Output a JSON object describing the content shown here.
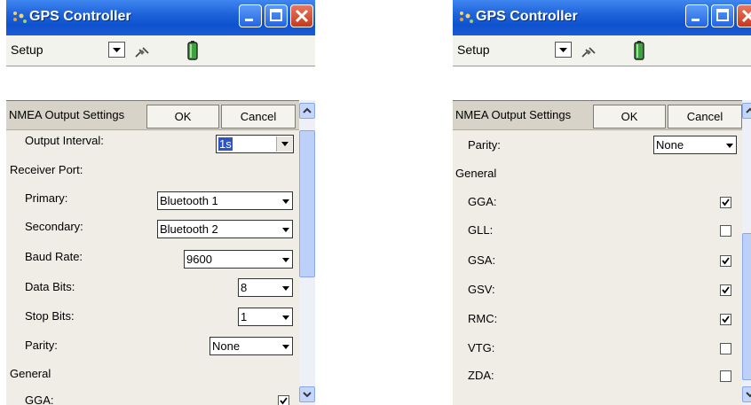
{
  "window": {
    "title": "GPS Controller",
    "title_bar_color": "#1f63da"
  },
  "toolbar": {
    "menu_label": "Setup",
    "icons": [
      "satellite-icon",
      "battery-icon"
    ]
  },
  "panel": {
    "title": "NMEA Output Settings",
    "ok_label": "OK",
    "cancel_label": "Cancel"
  },
  "left_view": {
    "output_interval_label": "Output Interval:",
    "output_interval_value": "1s",
    "receiver_port_label": "Receiver Port:",
    "primary_label": "Primary:",
    "primary_value": "Bluetooth 1",
    "secondary_label": "Secondary:",
    "secondary_value": "Bluetooth 2",
    "baud_rate_label": "Baud Rate:",
    "baud_rate_value": "9600",
    "data_bits_label": "Data Bits:",
    "data_bits_value": "8",
    "stop_bits_label": "Stop Bits:",
    "stop_bits_value": "1",
    "parity_label": "Parity:",
    "parity_value": "None",
    "general_label": "General",
    "gga_label": "GGA:",
    "gga_checked": true
  },
  "right_view": {
    "parity_label": "Parity:",
    "parity_value": "None",
    "general_label": "General",
    "sentences": [
      {
        "label": "GGA:",
        "checked": true
      },
      {
        "label": "GLL:",
        "checked": false
      },
      {
        "label": "GSA:",
        "checked": true
      },
      {
        "label": "GSV:",
        "checked": true
      },
      {
        "label": "RMC:",
        "checked": true
      },
      {
        "label": "VTG:",
        "checked": false
      },
      {
        "label": "ZDA:",
        "checked": false
      }
    ]
  }
}
